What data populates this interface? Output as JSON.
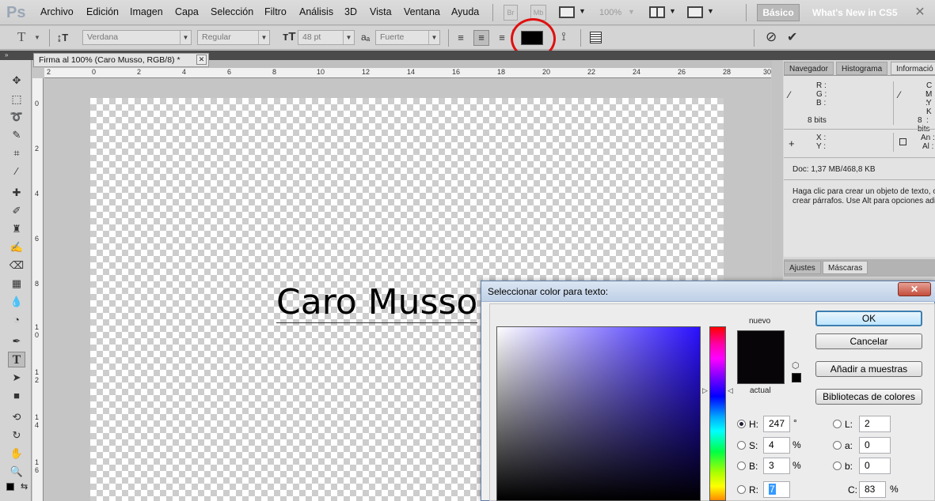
{
  "menubar": {
    "logo": "Ps",
    "items": [
      "Archivo",
      "Edición",
      "Imagen",
      "Capa",
      "Selección",
      "Filtro",
      "Análisis",
      "3D",
      "Vista",
      "Ventana",
      "Ayuda"
    ],
    "bridge": "Br",
    "minibridge": "Mb",
    "zoom": "100%",
    "workspace_active": "Básico",
    "workspace_new": "What's New in CS5",
    "close_glyph": "✕"
  },
  "options": {
    "tool_glyph": "T",
    "font_family": "Verdana",
    "font_style": "Regular",
    "font_size": "48 pt",
    "antialias_label": "aₐ",
    "antialias": "Fuerte",
    "text_color": "#000000",
    "cancel_glyph": "⊘",
    "commit_glyph": "✔"
  },
  "document": {
    "tab_title": "Firma al 100% (Caro Musso, RGB/8) *",
    "tab_close": "✕",
    "canvas_text": "Caro Musso"
  },
  "rulers": {
    "h_labels": [
      "2",
      "0",
      "2",
      "4",
      "6",
      "8",
      "10",
      "12",
      "14",
      "16",
      "18",
      "20",
      "22",
      "24",
      "26",
      "28",
      "30"
    ],
    "v_labels": [
      "0",
      "2",
      "4",
      "6",
      "8",
      "1 0",
      "1 2",
      "1 4",
      "1 6"
    ]
  },
  "panels": {
    "tabs": [
      "Navegador",
      "Histograma",
      "Informació"
    ],
    "info": {
      "r": "R :",
      "g": "G :",
      "b": "B :",
      "bits_left": "8 bits",
      "c": "C :",
      "m": "M :",
      "y": "Y :",
      "k": "K :",
      "bits_right": "8 bits",
      "x": "X :",
      "yy": "Y :",
      "an": "An :",
      "al": "Al :",
      "doc": "Doc: 1,37 MB/468,8 KB",
      "hint1": "Haga clic para crear un objeto de texto, o",
      "hint2": "crear párrafos. Use Alt para opciones adi"
    },
    "bottom_tabs": [
      "Ajustes",
      "Máscaras"
    ]
  },
  "dialog": {
    "title": "Seleccionar color para texto:",
    "close": "✕",
    "label_new": "nuevo",
    "label_current": "actual",
    "new_color": "#070508",
    "btn_ok": "OK",
    "btn_cancel": "Cancelar",
    "btn_add": "Añadir a muestras",
    "btn_libraries": "Bibliotecas de colores",
    "fields": {
      "h": {
        "label": "H:",
        "value": "247",
        "unit": "°"
      },
      "s": {
        "label": "S:",
        "value": "4",
        "unit": "%"
      },
      "b": {
        "label": "B:",
        "value": "3",
        "unit": "%"
      },
      "r": {
        "label": "R:",
        "value": "7"
      },
      "l": {
        "label": "L:",
        "value": "2"
      },
      "a": {
        "label": "a:",
        "value": "0"
      },
      "bb": {
        "label": "b:",
        "value": "0"
      },
      "c": {
        "label": "C:",
        "value": "83",
        "unit": "%"
      }
    }
  }
}
